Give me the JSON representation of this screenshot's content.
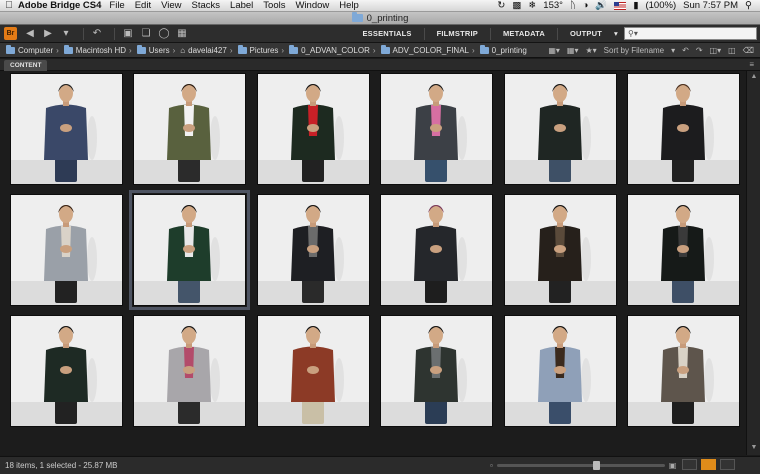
{
  "menubar": {
    "app_name": "Adobe Bridge CS4",
    "items": [
      "File",
      "Edit",
      "View",
      "Stacks",
      "Label",
      "Tools",
      "Window",
      "Help"
    ],
    "temperature": "153°",
    "battery": "(100%)",
    "clock": "Sun 7:57 PM"
  },
  "window": {
    "title": "0_printing"
  },
  "toolbar": {
    "logo": "Br",
    "workspaces": [
      "ESSENTIALS",
      "FILMSTRIP",
      "METADATA",
      "OUTPUT"
    ],
    "search_placeholder": ""
  },
  "path": {
    "crumbs": [
      "Computer",
      "Macintosh HD",
      "Users",
      "davelai427",
      "Pictures",
      "0_ADVAN_COLOR",
      "ADV_COLOR_FINAL",
      "0_printing"
    ],
    "sort_label": "Sort by Filename"
  },
  "content_panel": {
    "tab_label": "CONTENT"
  },
  "status": {
    "summary": "18 items, 1 selected - 25.87 MB"
  },
  "thumbnail_size": 0.6,
  "selected_index": 7,
  "accent_color": "#e08c1a",
  "thumbnails": [
    {
      "jacket": "#3a4868",
      "pants": "#2e3b55",
      "hair": "#222",
      "accent": ""
    },
    {
      "jacket": "#59613e",
      "pants": "#2b2b2b",
      "hair": "#2a1c12",
      "accent": "#f2f2f2"
    },
    {
      "jacket": "#1d2a20",
      "pants": "#222",
      "hair": "#151515",
      "accent": "#c82027"
    },
    {
      "jacket": "#3c4046",
      "pants": "#36506c",
      "hair": "#1a1a1a",
      "accent": "#d66fa2"
    },
    {
      "jacket": "#1f2623",
      "pants": "#3e5066",
      "hair": "#181818",
      "accent": ""
    },
    {
      "jacket": "#1c1c1e",
      "pants": "#222",
      "hair": "#4a3020",
      "accent": ""
    },
    {
      "jacket": "#9aa0a8",
      "pants": "#222",
      "hair": "#3a2416",
      "accent": "#d9d2c8"
    },
    {
      "jacket": "#1e3d2b",
      "pants": "#44556a",
      "hair": "#151515",
      "accent": "#e8e8e8"
    },
    {
      "jacket": "#1e1f23",
      "pants": "#2a2a2a",
      "hair": "#151515",
      "accent": "#6b6b6b"
    },
    {
      "jacket": "#25272b",
      "pants": "#1e1e1e",
      "hair": "#7a3a5c",
      "accent": ""
    },
    {
      "jacket": "#26201b",
      "pants": "#222",
      "hair": "#151515",
      "accent": "#5a4a3a"
    },
    {
      "jacket": "#161a18",
      "pants": "#3e4f66",
      "hair": "#151515",
      "accent": "#3a3a3a"
    },
    {
      "jacket": "#1e2a24",
      "pants": "#222",
      "hair": "#151515",
      "accent": ""
    },
    {
      "jacket": "#a8a6aa",
      "pants": "#2b2b2b",
      "hair": "#1a1a1a",
      "accent": "#b34b6a"
    },
    {
      "jacket": "#8c3a26",
      "pants": "#c9bfa6",
      "hair": "#151515",
      "accent": ""
    },
    {
      "jacket": "#2e3430",
      "pants": "#2b3d55",
      "hair": "#151515",
      "accent": "#6b6f70"
    },
    {
      "jacket": "#8fa0b8",
      "pants": "#3a4e6a",
      "hair": "#151515",
      "accent": "#3a2a1e"
    },
    {
      "jacket": "#5e554c",
      "pants": "#1e1e1e",
      "hair": "#151515",
      "accent": "#d9d2c6"
    }
  ]
}
